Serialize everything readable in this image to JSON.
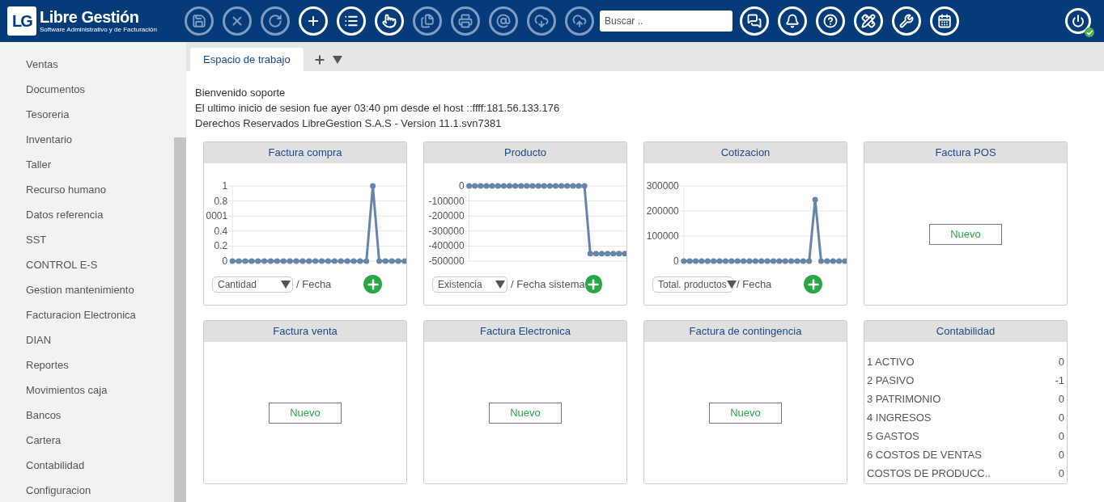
{
  "header": {
    "logo": {
      "mark": "LG",
      "name": "Libre Gestión",
      "tagline": "Software Administrativo y de Facturación"
    },
    "toolbar_left": [
      {
        "disabled": true
      },
      {
        "disabled": true
      },
      {
        "disabled": true
      },
      {
        "disabled": false
      },
      {
        "disabled": false
      },
      {
        "disabled": false
      },
      {
        "disabled": true
      },
      {
        "disabled": true
      },
      {
        "disabled": true
      },
      {
        "disabled": true
      },
      {
        "disabled": true
      }
    ],
    "search": {
      "placeholder": "Buscar .."
    },
    "toolbar_right": [
      {
        "disabled": false
      },
      {
        "disabled": false
      },
      {
        "disabled": false
      },
      {
        "disabled": false
      },
      {
        "disabled": false
      },
      {
        "disabled": false
      }
    ],
    "power": {
      "online": true
    }
  },
  "sidebar": {
    "items": [
      "Ventas",
      "Documentos",
      "Tesoreria",
      "Inventario",
      "Taller",
      "Recurso humano",
      "Datos referencia",
      "SST",
      "CONTROL E-S",
      "Gestion mantenimiento",
      "Facturacion Electronica",
      "DIAN",
      "Reportes",
      "Movimientos caja",
      "Bancos",
      "Cartera",
      "Contabilidad",
      "Configuracion"
    ]
  },
  "tabs": [
    {
      "label": "Espacio de trabajo",
      "selected": true
    }
  ],
  "welcome": [
    "Bienvenido soporte",
    "El ultimo inicio de sesion fue ayer 03:40 pm desde el host ::ffff:181.56.133.176",
    "Derechos Reservados LibreGestion S.A.S - Version 11.1.svn7381"
  ],
  "cards": [
    {
      "kind": "chart",
      "title": "Factura compra",
      "measure": "Cantidad",
      "axis_label": "/ Fecha",
      "chart_data": {
        "type": "line",
        "grid": true,
        "marker": true,
        "ylim": [
          0,
          1
        ],
        "yticks": [
          0,
          0.2,
          0.4,
          {
            "value": 0.6,
            "label": "0001"
          },
          0.8,
          1
        ],
        "values": [
          0,
          0,
          0,
          0,
          0,
          0,
          0,
          0,
          0,
          0,
          0,
          0,
          0,
          0,
          0,
          0,
          0,
          0,
          0,
          0,
          0,
          0,
          1,
          0,
          0,
          0,
          0,
          0
        ]
      }
    },
    {
      "kind": "chart",
      "title": "Producto",
      "measure": "Existencia",
      "axis_label": "/ Fecha sistema",
      "chart_data": {
        "type": "line",
        "grid": true,
        "marker": true,
        "ylim": [
          -500000,
          0
        ],
        "yticks": [
          -500000,
          -400000,
          -300000,
          -200000,
          -100000,
          0
        ],
        "values": [
          0,
          0,
          0,
          0,
          0,
          0,
          0,
          0,
          0,
          0,
          0,
          0,
          0,
          0,
          0,
          0,
          0,
          0,
          0,
          0,
          0,
          -450000,
          -450000,
          -450000,
          -450000,
          -450000,
          -450000,
          -450000
        ]
      }
    },
    {
      "kind": "chart",
      "title": "Cotizacion",
      "measure": "Total. productos",
      "axis_label": "/ Fecha",
      "chart_data": {
        "type": "line",
        "grid": true,
        "marker": true,
        "ylim": [
          0,
          300000
        ],
        "yticks": [
          0,
          100000,
          200000,
          300000
        ],
        "values": [
          0,
          0,
          0,
          0,
          0,
          0,
          0,
          0,
          0,
          0,
          0,
          0,
          0,
          0,
          0,
          0,
          0,
          0,
          0,
          0,
          0,
          0,
          245000,
          0,
          0,
          0,
          0,
          0
        ]
      }
    },
    {
      "kind": "new",
      "title": "Factura POS",
      "button_label": "Nuevo"
    },
    {
      "kind": "new",
      "title": "Factura venta",
      "button_label": "Nuevo"
    },
    {
      "kind": "new",
      "title": "Factura Electronica",
      "button_label": "Nuevo"
    },
    {
      "kind": "new",
      "title": "Factura de contingencia",
      "button_label": "Nuevo"
    },
    {
      "kind": "list",
      "title": "Contabilidad",
      "rows": [
        {
          "label": "1 ACTIVO",
          "value": "0"
        },
        {
          "label": "2 PASIVO",
          "value": "-1"
        },
        {
          "label": "3 PATRIMONIO",
          "value": "0"
        },
        {
          "label": "4 INGRESOS",
          "value": "0"
        },
        {
          "label": "5 GASTOS",
          "value": "0"
        },
        {
          "label": "6 COSTOS DE VENTAS",
          "value": "0"
        },
        {
          "label": "COSTOS DE PRODUCC..",
          "value": "0"
        }
      ]
    }
  ]
}
